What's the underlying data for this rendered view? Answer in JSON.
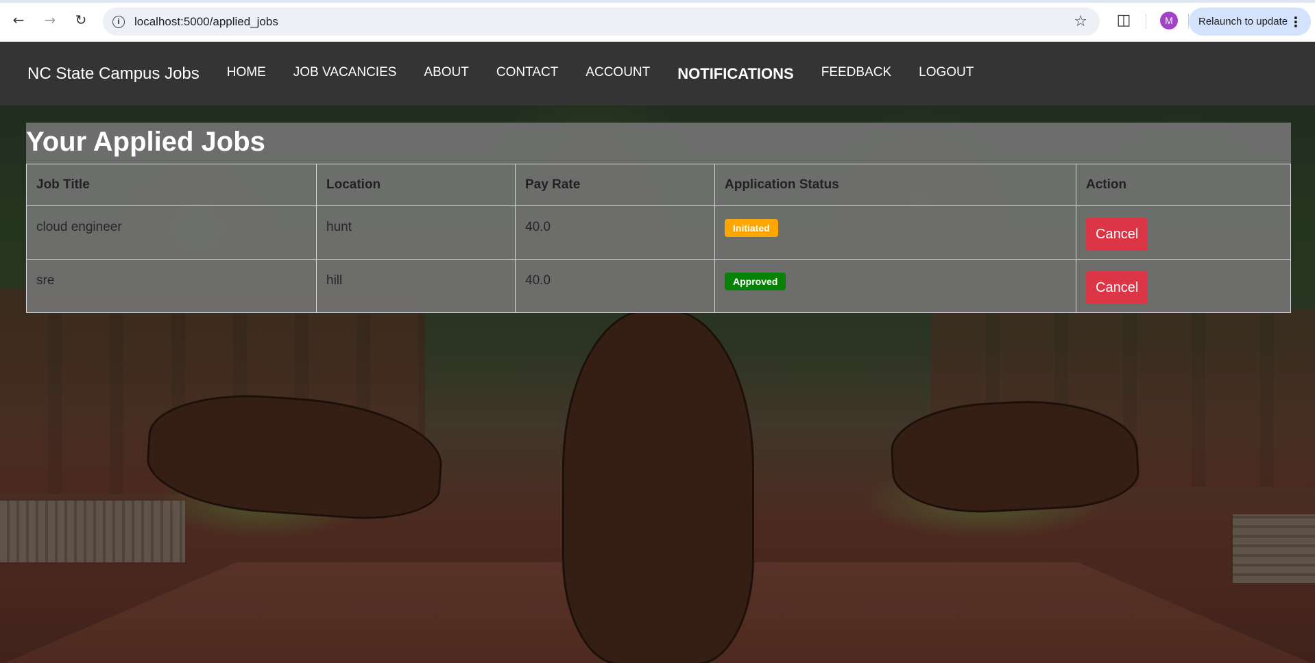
{
  "browser": {
    "url": "localhost:5000/applied_jobs",
    "profile_initial": "M",
    "relaunch_label": "Relaunch to update"
  },
  "nav": {
    "brand": "NC State Campus Jobs",
    "links": [
      "HOME",
      "JOB VACANCIES",
      "ABOUT",
      "CONTACT",
      "ACCOUNT",
      "NOTIFICATIONS",
      "FEEDBACK",
      "LOGOUT"
    ],
    "active": "NOTIFICATIONS"
  },
  "panel": {
    "title": "Your Applied Jobs",
    "columns": [
      "Job Title",
      "Location",
      "Pay Rate",
      "Application Status",
      "Action"
    ],
    "rows": [
      {
        "title": "cloud engineer",
        "location": "hunt",
        "pay": "40.0",
        "status": "Initiated",
        "action": "Cancel"
      },
      {
        "title": "sre",
        "location": "hill",
        "pay": "40.0",
        "status": "Approved",
        "action": "Cancel"
      }
    ]
  },
  "colors": {
    "navbar": "#343434",
    "initiated": "#ffa500",
    "approved": "#078207",
    "cancel": "#dc3545"
  },
  "icons": [
    "back-arrow-icon",
    "forward-arrow-icon",
    "reload-icon",
    "site-info-icon",
    "bookmark-star-icon",
    "extensions-icon",
    "kebab-menu-icon"
  ]
}
